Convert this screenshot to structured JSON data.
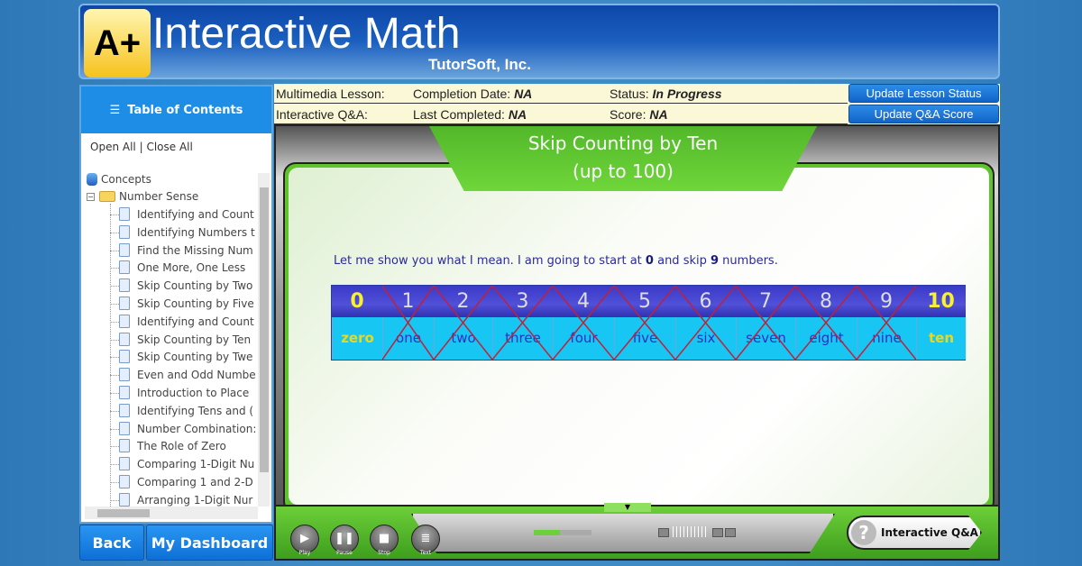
{
  "header": {
    "logo": "A+",
    "title": "Interactive Math",
    "company": "TutorSoft, Inc."
  },
  "sidebar": {
    "toc_label": "Table of Contents",
    "open_all": "Open All",
    "separator": "|",
    "close_all": "Close All",
    "root": "Concepts",
    "folder": "Number Sense",
    "items": [
      "Identifying and Count",
      "Identifying Numbers t",
      "Find the Missing Num",
      "One More, One Less",
      "Skip Counting by Two",
      "Skip Counting by Five",
      "Identifying and Count",
      "Skip Counting by Ten",
      "Skip Counting by Twe",
      "Even and Odd Numbe",
      "Introduction to Place",
      "Identifying Tens and (",
      "Number Combination:",
      "The Role of Zero",
      "Comparing 1-Digit Nu",
      "Comparing 1 and 2-D",
      "Arranging 1-Digit Nur"
    ]
  },
  "buttons": {
    "back": "Back",
    "dashboard": "My Dashboard"
  },
  "info": {
    "lesson_label": "Multimedia Lesson:",
    "completion_label": "Completion Date:",
    "completion_value": "NA",
    "status_label": "Status:",
    "status_value": "In Progress",
    "qa_label": "Interactive Q&A:",
    "last_label": "Last Completed:",
    "last_value": "NA",
    "score_label": "Score:",
    "score_value": "NA",
    "update_status": "Update Lesson Status",
    "update_score": "Update Q&A Score"
  },
  "lesson": {
    "title1": "Skip Counting by Ten",
    "title2": "(up to 100)",
    "msg_a": "Let me show you what I mean.  I am going to start at ",
    "msg_start": "0",
    "msg_b": " and skip ",
    "msg_skip": "9",
    "msg_c": " numbers.",
    "numbers": [
      "0",
      "1",
      "2",
      "3",
      "4",
      "5",
      "6",
      "7",
      "8",
      "9",
      "10"
    ],
    "words": [
      "zero",
      "one",
      "two",
      "three",
      "four",
      "five",
      "six",
      "seven",
      "eight",
      "nine",
      "ten"
    ],
    "crossed": [
      false,
      true,
      true,
      true,
      true,
      true,
      true,
      true,
      true,
      true,
      false
    ]
  },
  "player": {
    "play": "Play",
    "pause": "Pause",
    "stop": "Stop",
    "text": "Text",
    "progress": 0.45,
    "qa_button": "Interactive Q&A",
    "qa_icon": "?"
  }
}
